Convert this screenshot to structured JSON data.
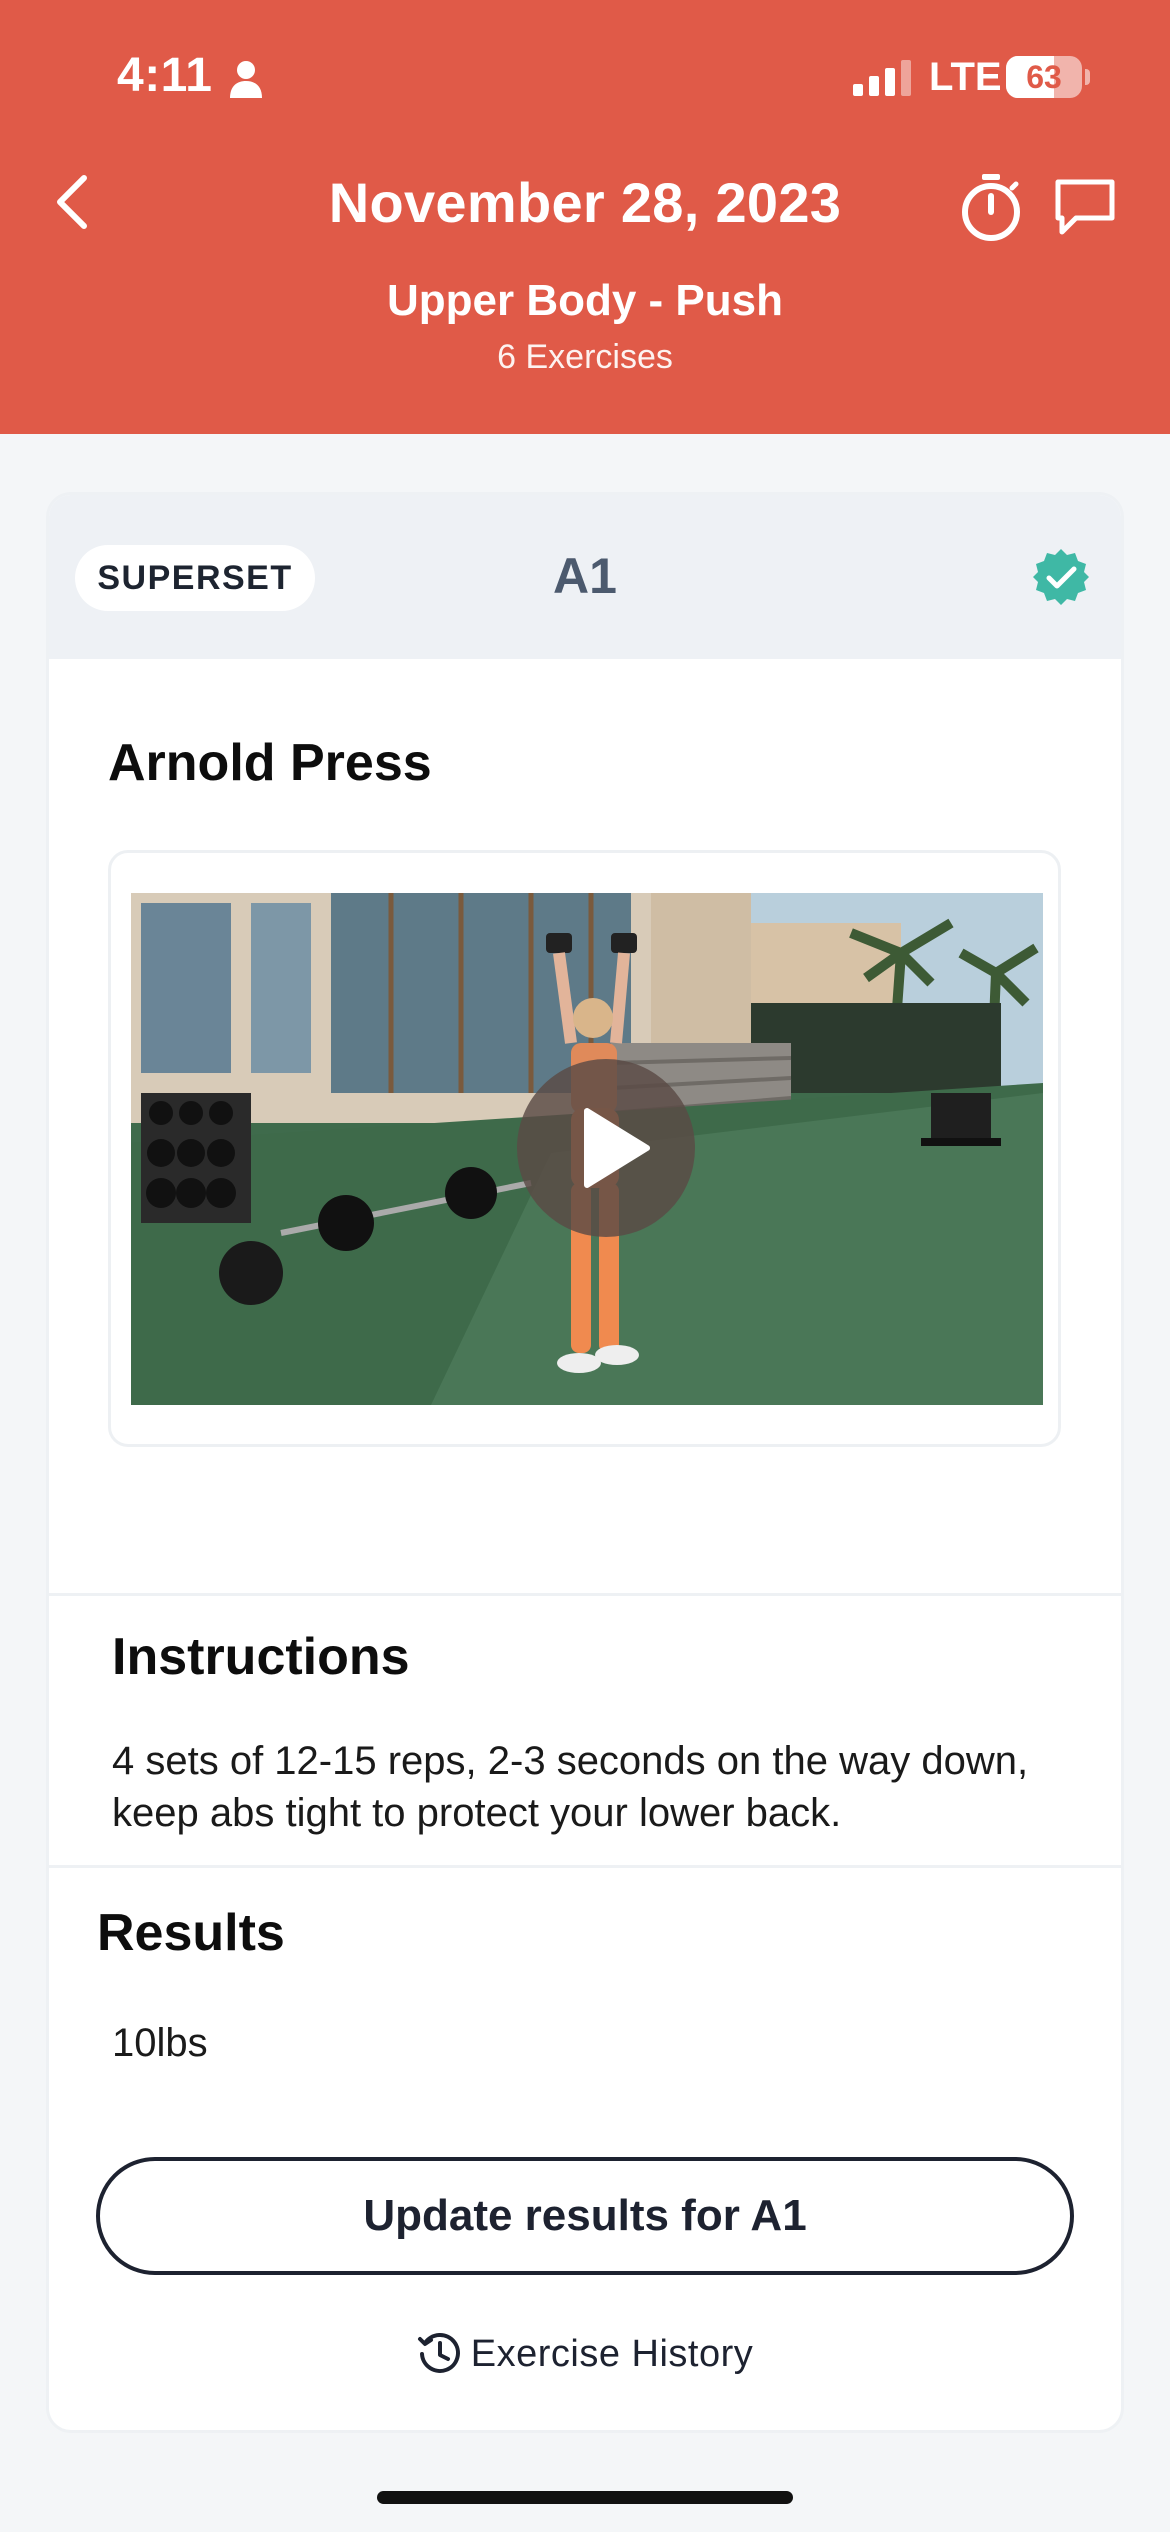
{
  "status_bar": {
    "time": "4:11",
    "network": "LTE",
    "battery_level": "63",
    "battery_fraction": 0.63
  },
  "header": {
    "date_title": "November 28, 2023",
    "workout_name": "Upper Body - Push",
    "exercise_count": "6 Exercises",
    "background_color": "#e05a48"
  },
  "card": {
    "badge": "SUPERSET",
    "block_label": "A1",
    "completed": true,
    "check_color": "#3fb8a5",
    "exercise_name": "Arnold Press"
  },
  "instructions": {
    "title": "Instructions",
    "text": "4 sets of 12-15 reps, 2-3 seconds on the way down, keep abs tight to protect your lower back."
  },
  "results": {
    "title": "Results",
    "value": "10lbs",
    "update_button": "Update results for A1"
  },
  "history": {
    "label": "Exercise History"
  }
}
